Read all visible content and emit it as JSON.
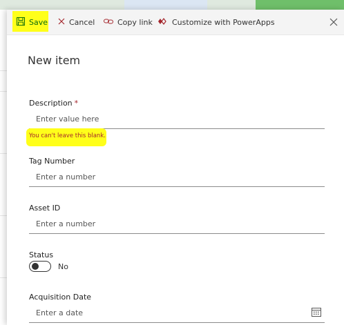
{
  "toolbar": {
    "save_label": "Save",
    "cancel_label": "Cancel",
    "copy_link_label": "Copy link",
    "customize_label": "Customize with PowerApps"
  },
  "form": {
    "title": "New item",
    "fields": {
      "description": {
        "label": "Description",
        "required_marker": "*",
        "placeholder": "Enter value here",
        "error": "You can't leave this blank."
      },
      "tag_number": {
        "label": "Tag Number",
        "placeholder": "Enter a number"
      },
      "asset_id": {
        "label": "Asset ID",
        "placeholder": "Enter a number"
      },
      "status": {
        "label": "Status",
        "value_text": "No",
        "checked": false
      },
      "acquisition_date": {
        "label": "Acquisition Date",
        "placeholder": "Enter a date"
      }
    }
  },
  "colors": {
    "highlight": "#ffff1a",
    "error": "#a4262c",
    "save_text": "#0b6a0b",
    "customize_icon": "#a4262c"
  }
}
